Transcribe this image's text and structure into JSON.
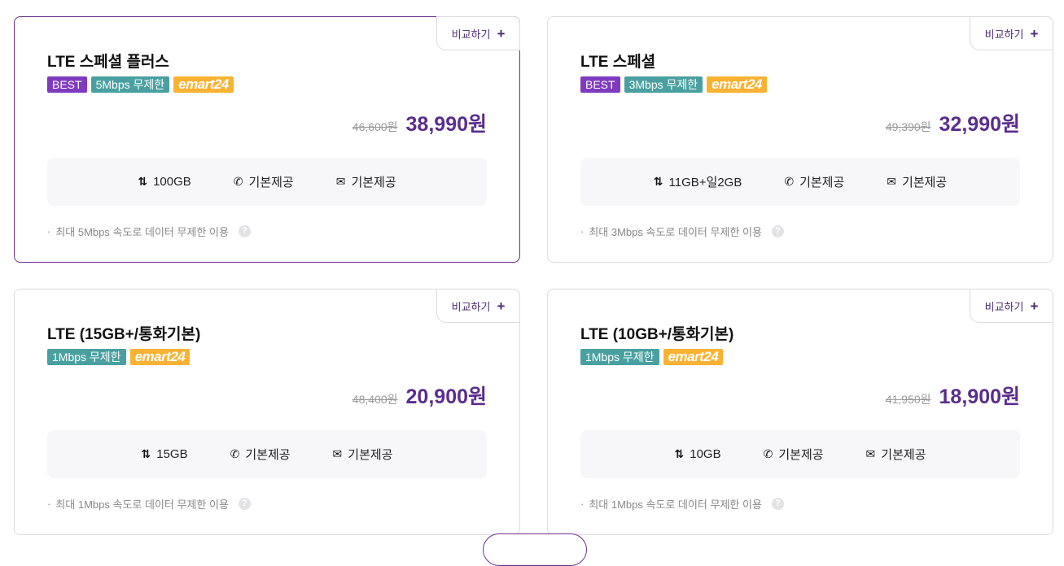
{
  "compare_label": "비교하기",
  "plans": [
    {
      "title": "LTE 스페셜 플러스",
      "tags": {
        "best": "BEST",
        "speed": "5Mbps 무제한",
        "emart": "emart24"
      },
      "old_price": "46,600원",
      "price": "38,990원",
      "data": "100GB",
      "call": "기본제공",
      "sms": "기본제공",
      "note": "최대 5Mbps 속도로 데이터 무제한 이용"
    },
    {
      "title": "LTE 스페셜",
      "tags": {
        "best": "BEST",
        "speed": "3Mbps 무제한",
        "emart": "emart24"
      },
      "old_price": "49,390원",
      "price": "32,990원",
      "data": "11GB+일2GB",
      "call": "기본제공",
      "sms": "기본제공",
      "note": "최대 3Mbps 속도로 데이터 무제한 이용"
    },
    {
      "title": "LTE (15GB+/통화기본)",
      "tags": {
        "speed": "1Mbps 무제한",
        "emart": "emart24"
      },
      "old_price": "48,400원",
      "price": "20,900원",
      "data": "15GB",
      "call": "기본제공",
      "sms": "기본제공",
      "note": "최대 1Mbps 속도로 데이터 무제한 이용"
    },
    {
      "title": "LTE (10GB+/통화기본)",
      "tags": {
        "speed": "1Mbps 무제한",
        "emart": "emart24"
      },
      "old_price": "41,950원",
      "price": "18,900원",
      "data": "10GB",
      "call": "기본제공",
      "sms": "기본제공",
      "note": "최대 1Mbps 속도로 데이터 무제한 이용"
    }
  ],
  "icons": {
    "data": "data-transfer-icon",
    "call": "phone-icon",
    "sms": "mail-icon",
    "help": "help-icon",
    "compare": "plus-icon"
  },
  "colors": {
    "accent": "#5b2d8e",
    "best_tag": "#7e3bbf",
    "speed_tag": "#4aa0a0",
    "emart_tag": "#f9b233"
  }
}
